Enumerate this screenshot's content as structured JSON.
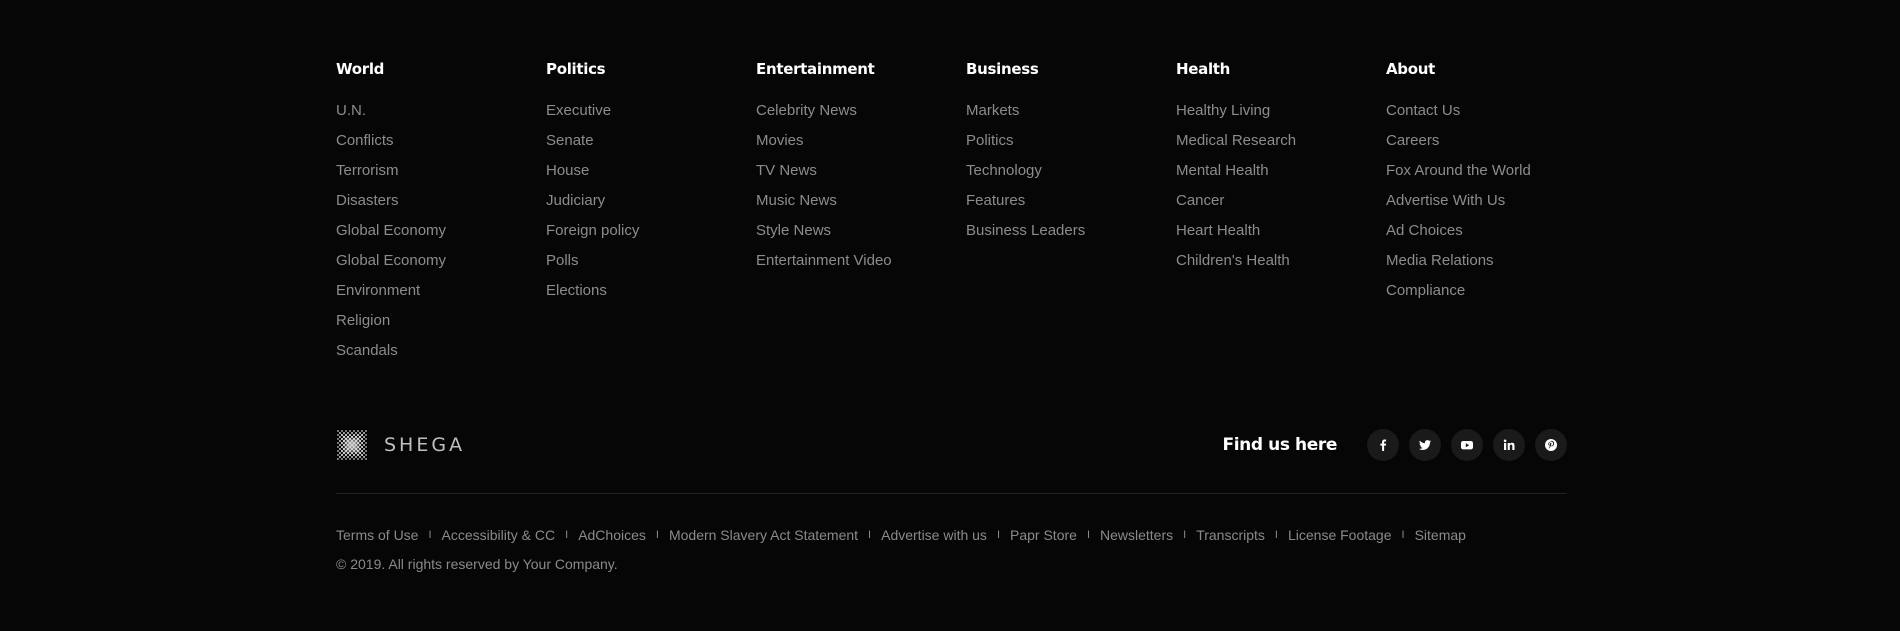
{
  "columns": [
    {
      "heading": "World",
      "items": [
        "U.N.",
        "Conflicts",
        "Terrorism",
        "Disasters",
        "Global Economy",
        "Global Economy",
        "Environment",
        "Religion",
        "Scandals"
      ]
    },
    {
      "heading": "Politics",
      "items": [
        "Executive",
        "Senate",
        "House",
        "Judiciary",
        "Foreign policy",
        "Polls",
        "Elections"
      ]
    },
    {
      "heading": "Entertainment",
      "items": [
        "Celebrity News",
        "Movies",
        "TV News",
        "Music News",
        "Style News",
        "Entertainment Video"
      ]
    },
    {
      "heading": "Business",
      "items": [
        "Markets",
        "Politics",
        "Technology",
        "Features",
        "Business Leaders"
      ]
    },
    {
      "heading": "Health",
      "items": [
        "Healthy Living",
        "Medical Research",
        "Mental Health",
        "Cancer",
        "Heart Health",
        "Children's Health"
      ]
    },
    {
      "heading": "About",
      "items": [
        "Contact Us",
        "Careers",
        "Fox Around the World",
        "Advertise With Us",
        "Ad Choices",
        "Media Relations",
        "Compliance"
      ]
    }
  ],
  "brand": {
    "name": "SHEGA"
  },
  "social": {
    "label": "Find us here",
    "icons": [
      "facebook-icon",
      "twitter-icon",
      "youtube-icon",
      "linkedin-icon",
      "pinterest-icon"
    ]
  },
  "legal": {
    "links": [
      "Terms of Use",
      "Accessibility & CC",
      "AdChoices",
      "Modern Slavery Act Statement",
      "Advertise with us",
      "Papr Store",
      "Newsletters",
      "Transcripts",
      "License Footage",
      "Sitemap"
    ],
    "separator": "I",
    "copyright": "© 2019. All rights reserved by Your Company."
  },
  "colors": {
    "background": "#060606",
    "heading": "#ffffff",
    "link": "#8c8c8c",
    "social_bg": "#1a1a1a"
  }
}
